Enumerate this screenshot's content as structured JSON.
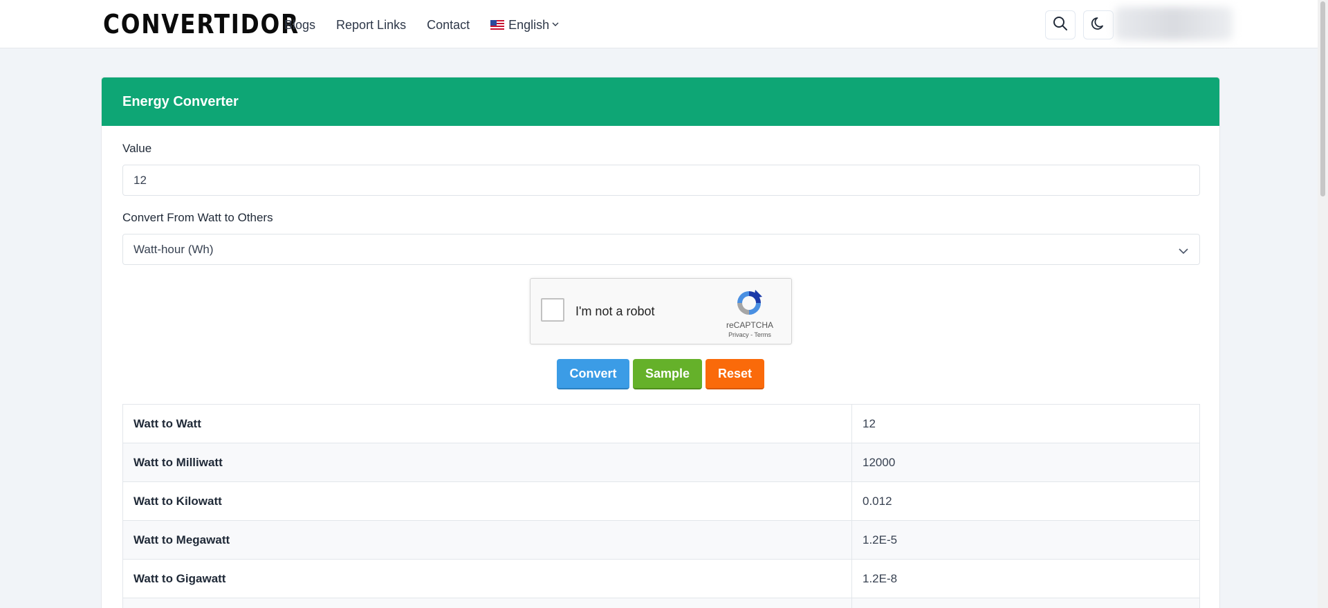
{
  "header": {
    "logo": "CONVERTIDOR",
    "nav": [
      "Blogs",
      "Report Links",
      "Contact"
    ],
    "language": "English"
  },
  "card": {
    "title": "Energy Converter",
    "value_label": "Value",
    "value": "12",
    "convert_label": "Convert From Watt to Others",
    "selected_unit": "Watt-hour (Wh)"
  },
  "captcha": {
    "text": "I'm not a robot",
    "brand": "reCAPTCHA",
    "links": "Privacy - Terms"
  },
  "buttons": {
    "convert": "Convert",
    "sample": "Sample",
    "reset": "Reset"
  },
  "results": [
    {
      "name": "Watt to Watt",
      "value": "12"
    },
    {
      "name": "Watt to Milliwatt",
      "value": "12000"
    },
    {
      "name": "Watt to Kilowatt",
      "value": "0.012"
    },
    {
      "name": "Watt to Megawatt",
      "value": "1.2E-5"
    },
    {
      "name": "Watt to Gigawatt",
      "value": "1.2E-8"
    },
    {
      "name": "",
      "value": ""
    }
  ],
  "colors": {
    "header_green": "#0ea675",
    "convert_blue": "#3b9ce6",
    "sample_green": "#65b12a",
    "reset_orange": "#fa6a0a"
  },
  "icons": [
    "search-icon",
    "moon-icon",
    "chevron-down-icon",
    "us-flag-icon",
    "recaptcha-logo-icon"
  ]
}
